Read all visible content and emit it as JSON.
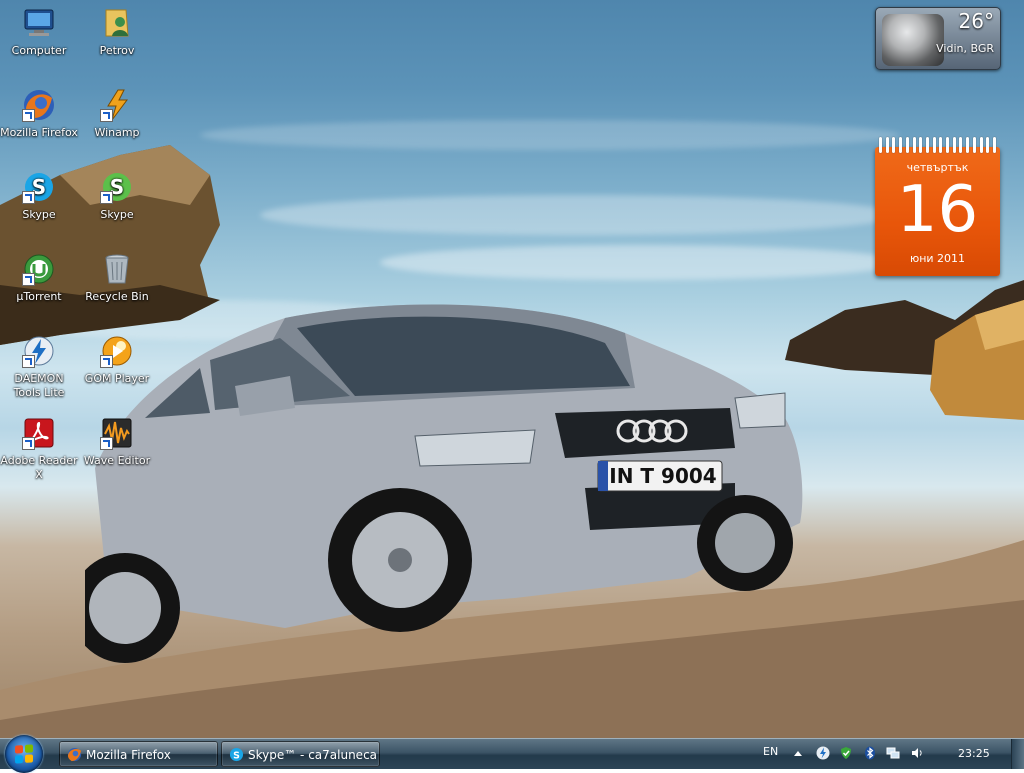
{
  "desktop": {
    "icons": [
      {
        "label": "Computer"
      },
      {
        "label": "Petrov"
      },
      {
        "label": "Mozilla Firefox"
      },
      {
        "label": "Winamp"
      },
      {
        "label": "Skype"
      },
      {
        "label": "Skype"
      },
      {
        "label": "µTorrent"
      },
      {
        "label": "Recycle Bin"
      },
      {
        "label": "DAEMON Tools Lite"
      },
      {
        "label": "GOM Player"
      },
      {
        "label": "Adobe Reader X"
      },
      {
        "label": "Wave Editor"
      }
    ],
    "wallpaper": {
      "license_plate": "IN T 9004"
    }
  },
  "gadgets": {
    "weather": {
      "temperature": "26°",
      "location": "Vidin, BGR"
    },
    "calendar": {
      "weekday": "четвъртък",
      "day": "16",
      "month_year": "юни 2011",
      "color": "#e8560a"
    }
  },
  "taskbar": {
    "start_button_icon": "windows-logo-icon",
    "tasks": [
      {
        "label": "Mozilla Firefox",
        "icon": "firefox-icon"
      },
      {
        "label": "Skype™ - ca7aluneca",
        "icon": "skype-icon"
      }
    ],
    "tray": {
      "language": "EN",
      "icons": [
        "show-hidden-icons-icon",
        "daemon-tools-tray-icon",
        "security-shield-icon",
        "bluetooth-icon",
        "network-icon",
        "volume-icon"
      ],
      "clock": "23:25"
    }
  }
}
